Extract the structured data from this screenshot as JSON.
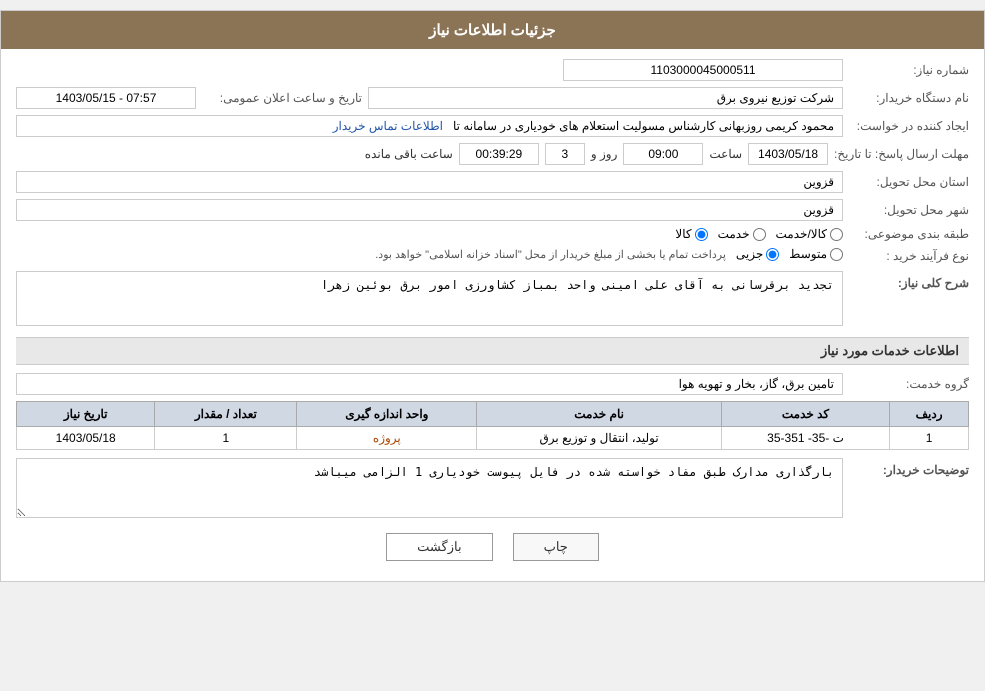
{
  "page": {
    "title": "جزئیات اطلاعات نیاز"
  },
  "header": {
    "need_number_label": "شماره نیاز:",
    "need_number_value": "1103000045000511",
    "device_name_label": "نام دستگاه خریدار:",
    "device_name_value": "شرکت توزیع نیروی برق",
    "datetime_label": "تاریخ و ساعت اعلان عمومی:",
    "datetime_value": "1403/05/15 - 07:57",
    "creator_label": "ایجاد کننده در خواست:",
    "creator_value": "محمود کریمی روزبهانی کارشناس  مسولیت استعلام های خودیاری در سامانه تا",
    "creator_link": "اطلاعات تماس خریدار",
    "deadline_label": "مهلت ارسال پاسخ: تا تاریخ:",
    "deadline_date": "1403/05/18",
    "deadline_time_label": "ساعت",
    "deadline_time": "09:00",
    "deadline_day_label": "روز و",
    "deadline_days": "3",
    "deadline_remaining_label": "ساعت باقی مانده",
    "deadline_remaining": "00:39:29",
    "province_label": "استان محل تحویل:",
    "province_value": "قزوین",
    "city_label": "شهر محل تحویل:",
    "city_value": "قزوین",
    "category_label": "طبقه بندی موضوعی:",
    "category_kala": "کالا",
    "category_khadamat": "خدمت",
    "category_kala_khadamat": "کالا/خدمت",
    "process_label": "نوع فرآیند خرید :",
    "process_jozii": "جزیی",
    "process_motavaset": "متوسط",
    "process_description": "پرداخت تمام یا بخشی از مبلغ خریدار از محل \"اسناد خزانه اسلامی\" خواهد بود."
  },
  "description": {
    "label": "شرح کلی نیاز:",
    "value": "تجدید برقرسانی به آقای علی امینی واحد بمباز کشاورزی امور برق بوئین زهرا"
  },
  "services_section": {
    "title": "اطلاعات خدمات مورد نیاز",
    "service_group_label": "گروه خدمت:",
    "service_group_value": "تامین برق، گاز، بخار و تهویه هوا",
    "table": {
      "headers": [
        "ردیف",
        "کد خدمت",
        "نام خدمت",
        "واحد اندازه گیری",
        "تعداد / مقدار",
        "تاریخ نیاز"
      ],
      "rows": [
        {
          "row_num": "1",
          "code": "ت -35- 351-35",
          "name": "تولید، انتقال و توزیع برق",
          "unit": "پروژه",
          "quantity": "1",
          "date": "1403/05/18"
        }
      ]
    }
  },
  "buyer_notes": {
    "label": "توضیحات خریدار:",
    "value": "بارگذاری مدارک طبق مفاد خواسته شده در فایل پیوست خودیاری 1 الزامی میباشد"
  },
  "buttons": {
    "print": "چاپ",
    "back": "بازگشت"
  }
}
